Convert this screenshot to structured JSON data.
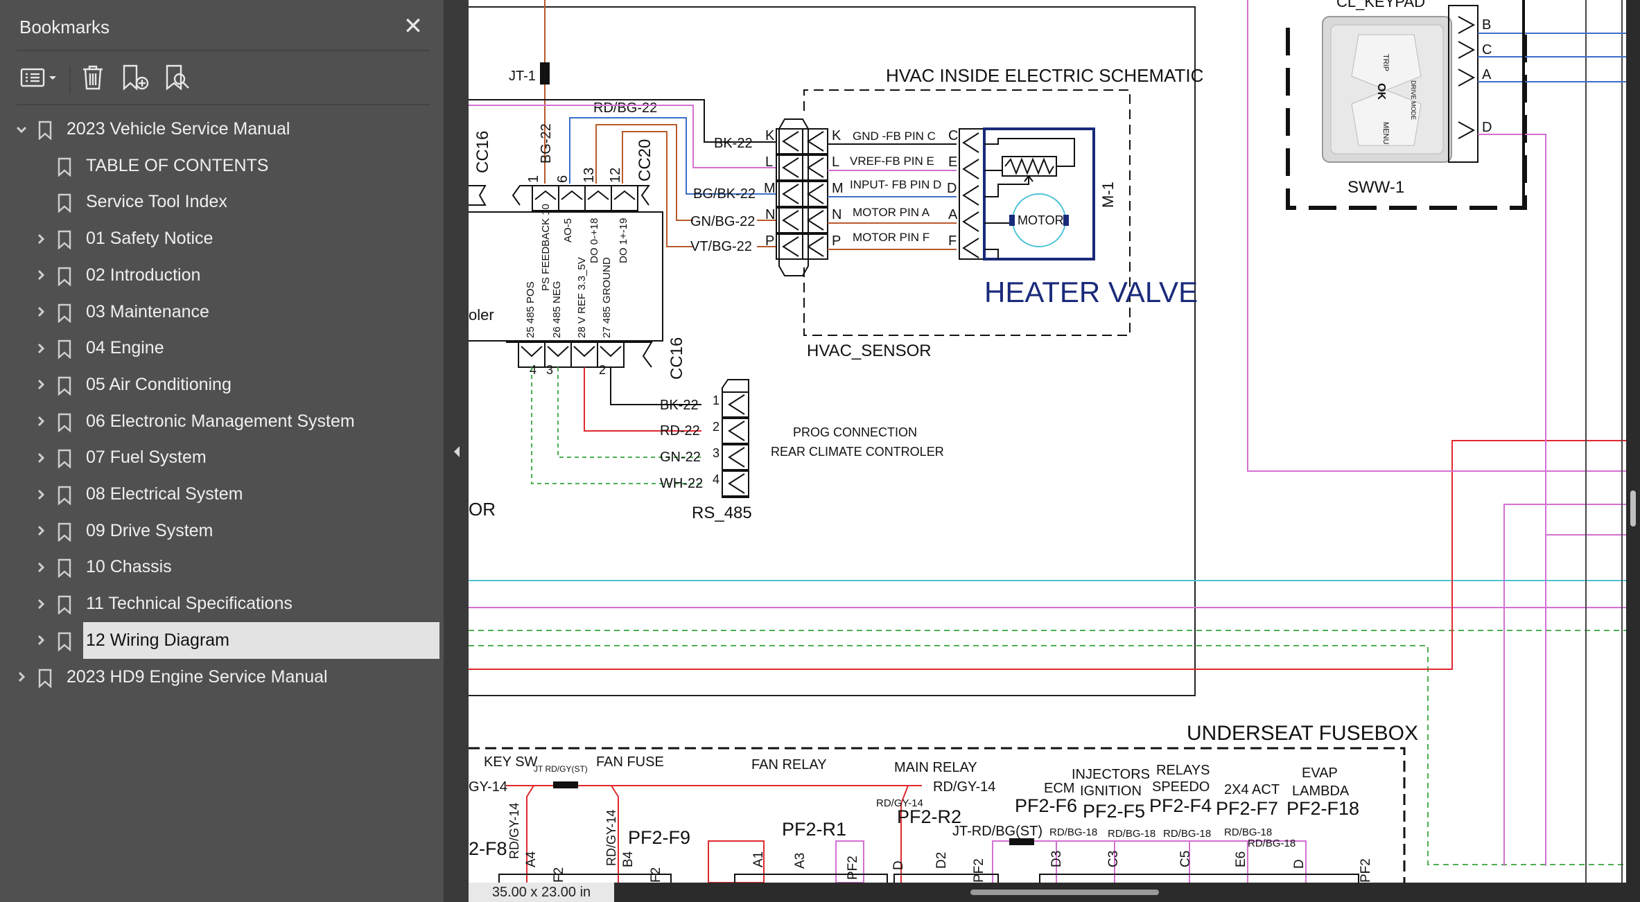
{
  "panel": {
    "title": "Bookmarks",
    "close_glyph": "✕",
    "toolbar_icons": [
      "options-icon",
      "delete-bookmark-icon",
      "add-bookmark-icon",
      "find-bookmark-icon"
    ],
    "items": [
      {
        "label": "2023 Vehicle Service Manual",
        "level": 0,
        "expanded": true
      },
      {
        "label": "TABLE OF CONTENTS",
        "level": 1
      },
      {
        "label": "Service Tool Index",
        "level": 1
      },
      {
        "label": "01 Safety Notice",
        "level": 1,
        "expandable": true
      },
      {
        "label": "02 Introduction",
        "level": 1,
        "expandable": true
      },
      {
        "label": "03 Maintenance",
        "level": 1,
        "expandable": true
      },
      {
        "label": "04 Engine",
        "level": 1,
        "expandable": true
      },
      {
        "label": "05 Air Conditioning",
        "level": 1,
        "expandable": true
      },
      {
        "label": "06 Electronic Management System",
        "level": 1,
        "expandable": true
      },
      {
        "label": "07 Fuel System",
        "level": 1,
        "expandable": true
      },
      {
        "label": "08 Electrical System",
        "level": 1,
        "expandable": true
      },
      {
        "label": "09 Drive System",
        "level": 1,
        "expandable": true
      },
      {
        "label": "10 Chassis",
        "level": 1,
        "expandable": true
      },
      {
        "label": "11 Technical Specifications",
        "level": 1,
        "expandable": true
      },
      {
        "label": "12 Wiring Diagram",
        "level": 1,
        "expandable": true,
        "selected": true
      },
      {
        "label": "2023 HD9  Engine Service Manual",
        "level": 0,
        "expandable": true
      }
    ]
  },
  "status": {
    "page_size": "35.00 x 23.00 in"
  },
  "colors": {
    "panel_bg": "#505050",
    "selected_bg": "#e3e3e3",
    "wire_red": "#e0282e",
    "wire_blue": "#3b6fc9",
    "wire_pink": "#d36fd3",
    "wire_green": "#4caf50",
    "wire_cyan": "#4fc3d6",
    "motor_border": "#1a2a7a"
  },
  "schematic": {
    "hvac_title": "HVAC INSIDE ELECTRIC SCHEMATIC",
    "jt1": "JT-1",
    "rd_bg_22": "RD/BG-22",
    "bg_22": "BG-22",
    "cc16_top": "CC16",
    "cc20": "CC20",
    "cc16_bottom": "CC16",
    "pin_top_nums": [
      "1",
      "6",
      "13",
      "12"
    ],
    "pin_top_labels": [
      "PS FEEDBACK 10",
      "AO-5",
      "DO 0-+18",
      "DO 1+-19"
    ],
    "pin_bottom_labels": [
      "25 485 POS",
      "26 485 NEG",
      "28 V REF 3.3_5V",
      "27 485 GROUND"
    ],
    "pin_bottom_nums": [
      "4",
      "3",
      "2"
    ],
    "controller_frag": "oler",
    "or_frag": "OR",
    "left_wires": [
      "BK-22",
      "BG/BK-22",
      "GN/BG-22",
      "VT/BG-22"
    ],
    "conn_letters": [
      "K",
      "L",
      "M",
      "N",
      "P"
    ],
    "mid_rows": [
      "GND -FB PIN C",
      "VREF-FB PIN E",
      "INPUT- FB PIN D",
      "MOTOR PIN A",
      "MOTOR PIN F"
    ],
    "right_letters": [
      "C",
      "E",
      "D",
      "A",
      "F"
    ],
    "motor": "MOTOR",
    "m1": "M-1",
    "heater_valve": "HEATER  VALVE",
    "hvac_sensor": "HVAC_SENSOR",
    "rs_wires": [
      "BK-22",
      "RD-22",
      "GN-22",
      "WH-22"
    ],
    "rs_pins": [
      "1",
      "2",
      "3",
      "4"
    ],
    "rs_name": "RS_485",
    "prog1": "PROG CONNECTION",
    "prog2": "REAR CLIMATE CONTROLER",
    "keypad_title": "CL_KEYPAD",
    "keypad_letters": [
      "B",
      "C",
      "A",
      "D"
    ],
    "keypad_buttons": [
      "TRIP",
      "OK",
      "DRIVE MODE",
      "MENU"
    ],
    "sww": "SWW-1",
    "fusebox_title": "UNDERSEAT  FUSEBOX",
    "fb_keysw": "KEY SW",
    "fb_jt_small": "JT RD/GY(ST)",
    "fb_fanfuse": "FAN FUSE",
    "fb_fanrelay": "FAN RELAY",
    "fb_mainrelay": "MAIN RELAY",
    "fb_gy14": "GY-14",
    "fb_rdgy14": "RD/GY-14",
    "fb_ecm": "ECM",
    "fb_inj1": "INJECTORS",
    "fb_inj2": "IGNITION",
    "fb_rel1": "RELAYS",
    "fb_rel2": "SPEEDO",
    "fb_2x4": "2X4 ACT",
    "fb_evap1": "EVAP",
    "fb_evap2": "LAMBDA",
    "fb_f6": "PF2-F6",
    "fb_f5": "PF2-F5",
    "fb_f4": "PF2-F4",
    "fb_f7": "PF2-F7",
    "fb_f18": "PF2-F18",
    "fb_f8": "2-F8",
    "fb_f9": "PF2-F9",
    "fb_r1": "PF2-R1",
    "fb_r2": "PF2-R2",
    "fb_rdgy14_v1": "RD/GY-14",
    "fb_rdgy14_v2": "RD/GY-14",
    "fb_rdgy14_small": "RD/GY-14",
    "fb_jt_rdbg": "JT-RD/BG(ST)",
    "fb_rdbg18": "RD/BG-18",
    "fb_pins": [
      "A4",
      "F2",
      "B4",
      "F2",
      "A1",
      "A3",
      "PF2",
      "D",
      "D2",
      "PF2",
      "D3",
      "C3",
      "C5",
      "E6",
      "D",
      "PF2"
    ]
  }
}
